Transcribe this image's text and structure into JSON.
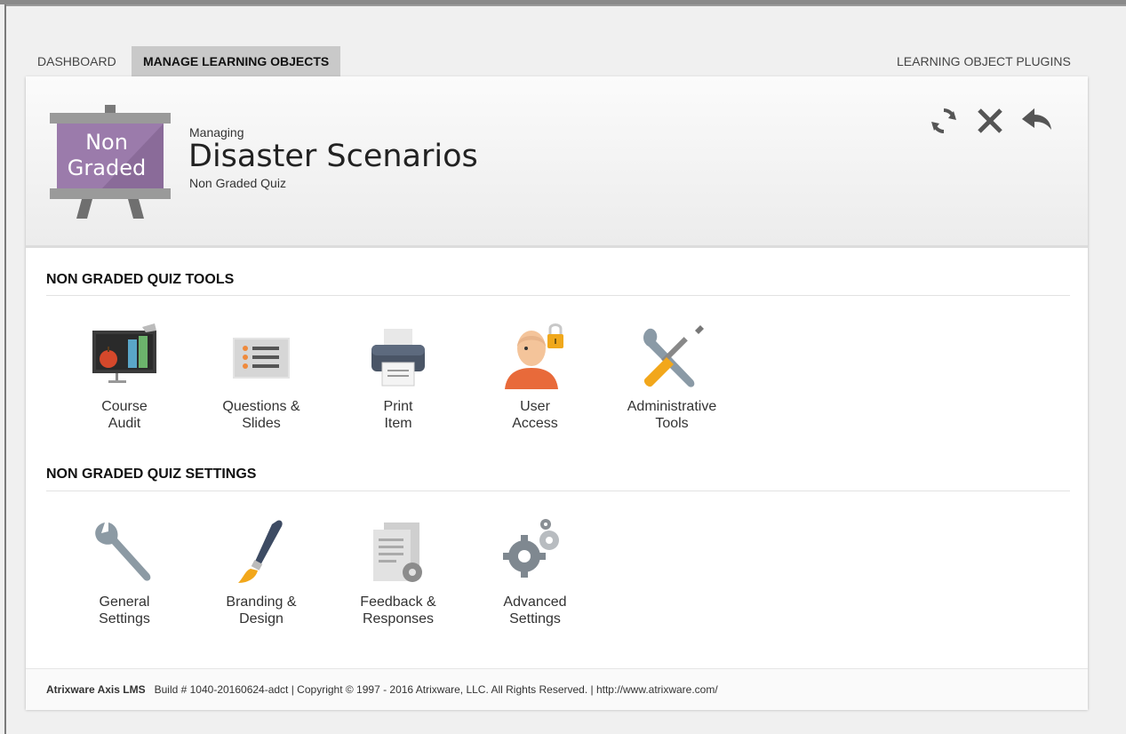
{
  "nav": {
    "tabs": [
      {
        "label": "DASHBOARD"
      },
      {
        "label": "MANAGE LEARNING OBJECTS"
      }
    ],
    "right_link": "LEARNING OBJECT PLUGINS"
  },
  "header": {
    "badge_line1": "Non",
    "badge_line2": "Graded",
    "managing_label": "Managing",
    "title": "Disaster Scenarios",
    "subtitle": "Non Graded Quiz",
    "actions": [
      "refresh-icon",
      "close-icon",
      "back-icon"
    ]
  },
  "tools_section": {
    "title": "NON GRADED QUIZ TOOLS",
    "items": [
      {
        "line1": "Course",
        "line2": "Audit",
        "icon": "course-audit-icon"
      },
      {
        "line1": "Questions &",
        "line2": "Slides",
        "icon": "questions-slides-icon"
      },
      {
        "line1": "Print",
        "line2": "Item",
        "icon": "printer-icon"
      },
      {
        "line1": "User",
        "line2": "Access",
        "icon": "user-access-icon"
      },
      {
        "line1": "Administrative",
        "line2": "Tools",
        "icon": "administrative-tools-icon"
      }
    ]
  },
  "settings_section": {
    "title": "NON GRADED QUIZ SETTINGS",
    "items": [
      {
        "line1": "General",
        "line2": "Settings",
        "icon": "wrench-icon"
      },
      {
        "line1": "Branding &",
        "line2": "Design",
        "icon": "paintbrush-icon"
      },
      {
        "line1": "Feedback &",
        "line2": "Responses",
        "icon": "feedback-document-icon"
      },
      {
        "line1": "Advanced",
        "line2": "Settings",
        "icon": "gears-icon"
      }
    ]
  },
  "footer": {
    "brand": "Atrixware Axis LMS",
    "text": "Build # 1040-20160624-adct | Copyright © 1997 - 2016 Atrixware, LLC. All Rights Reserved. |  http://www.atrixware.com/"
  },
  "colors": {
    "badge_purple": "#9b7bab",
    "active_tab": "#c9c9c9"
  }
}
